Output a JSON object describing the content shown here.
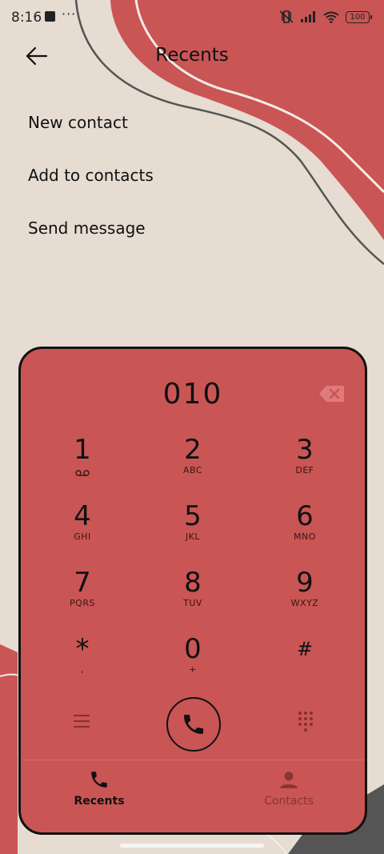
{
  "status_bar": {
    "time": "8:16",
    "more": "···",
    "battery": "100"
  },
  "header": {
    "title": "Recents"
  },
  "menu": {
    "items": [
      "New contact",
      "Add to contacts",
      "Send message"
    ]
  },
  "dialer": {
    "number": "010",
    "keys": [
      {
        "num": "1",
        "letters": ""
      },
      {
        "num": "2",
        "letters": "ABC"
      },
      {
        "num": "3",
        "letters": "DEF"
      },
      {
        "num": "4",
        "letters": "GHI"
      },
      {
        "num": "5",
        "letters": "JKL"
      },
      {
        "num": "6",
        "letters": "MNO"
      },
      {
        "num": "7",
        "letters": "PQRS"
      },
      {
        "num": "8",
        "letters": "TUV"
      },
      {
        "num": "9",
        "letters": "WXYZ"
      },
      {
        "num": "*",
        "letters": ","
      },
      {
        "num": "0",
        "letters": "+"
      },
      {
        "num": "#",
        "letters": ""
      }
    ]
  },
  "tabs": [
    {
      "label": "Recents",
      "icon": "phone-icon",
      "active": true
    },
    {
      "label": "Contacts",
      "icon": "person-icon",
      "active": false
    }
  ],
  "colors": {
    "background": "#e6dcd1",
    "accent": "#c95555",
    "dark": "#555555"
  }
}
